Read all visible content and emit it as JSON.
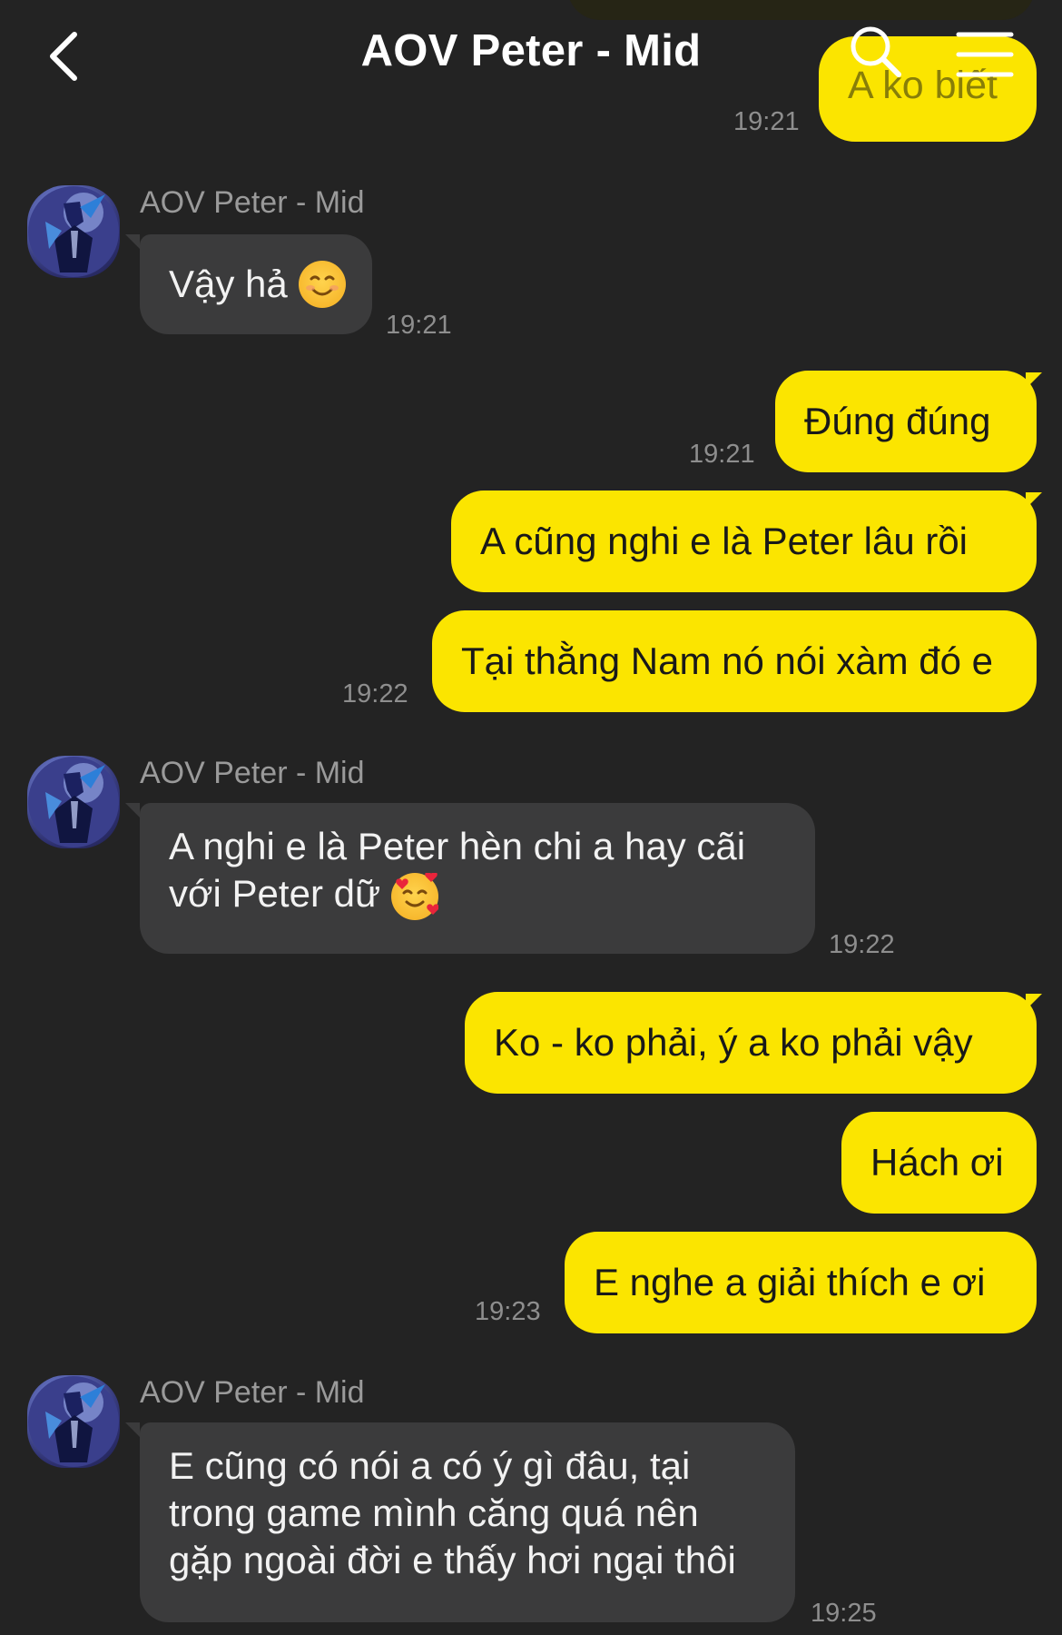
{
  "header": {
    "title": "AOV Peter - Mid",
    "icons": {
      "back": "chevron-left-icon",
      "search": "search-icon",
      "menu": "hamburger-menu-icon"
    }
  },
  "colors": {
    "background": "#232323",
    "outgoing_bubble": "#fbe500",
    "incoming_bubble": "#3b3b3c",
    "timestamp": "#8e8e8e"
  },
  "messages": {
    "top_partial": {
      "text": "A ko biết",
      "time": "19:21"
    },
    "group1": {
      "sender": "AOV Peter - Mid",
      "text": "Vậy hả",
      "emoji": "smiling-face-emoji",
      "time": "19:21"
    },
    "group2": {
      "m1": {
        "text": "Đúng đúng",
        "time": "19:21"
      },
      "m2": {
        "text": "A cũng nghi e là Peter lâu rồi"
      },
      "m3": {
        "text": "Tại thằng Nam nó nói xàm đó e",
        "time": "19:22"
      }
    },
    "group3": {
      "sender": "AOV Peter - Mid",
      "line1": "A nghi e là Peter hèn chi a hay cãi",
      "line2": "với Peter dữ",
      "emoji": "smiling-face-with-hearts-emoji",
      "time": "19:22"
    },
    "group4": {
      "m1": {
        "text": "Ko - ko phải, ý a ko phải vậy"
      },
      "m2": {
        "text": "Hách ơi"
      },
      "m3": {
        "text": "E nghe a giải thích e ơi",
        "time": "19:23"
      }
    },
    "group5": {
      "sender": "AOV Peter - Mid",
      "line1": "E cũng có nói a có ý gì đâu, tại",
      "line2": "trong game mình căng quá nên",
      "line3": "gặp ngoài đời e thấy hơi ngại thôi",
      "time": "19:25"
    }
  }
}
